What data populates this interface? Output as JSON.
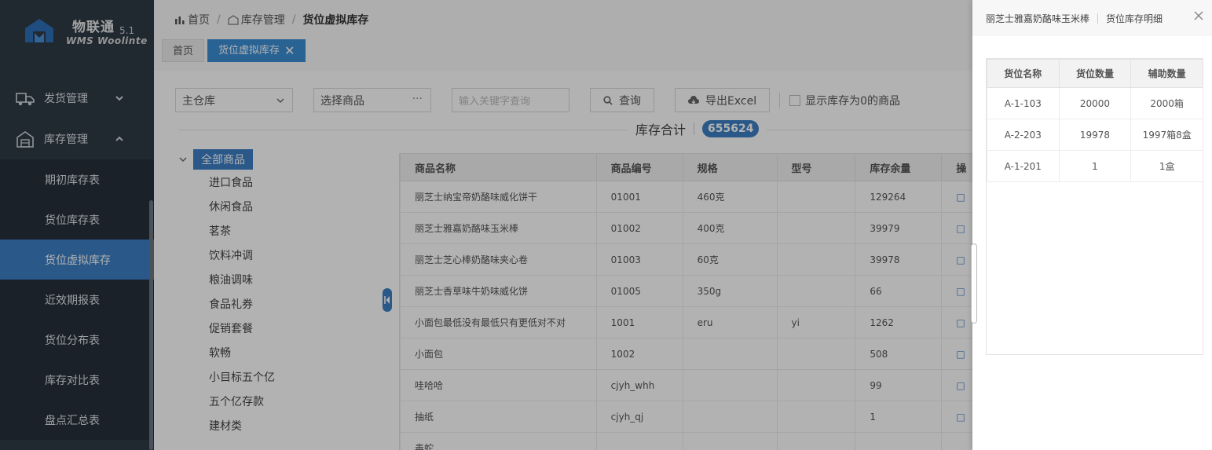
{
  "app": {
    "title": "物联通",
    "version": "5.1",
    "subtitle": "WMS Woolinte"
  },
  "sidebar": {
    "groups": [
      {
        "label": "发货管理",
        "icon": "truck-icon",
        "expanded": false
      },
      {
        "label": "库存管理",
        "icon": "warehouse-icon",
        "expanded": true
      }
    ],
    "items": [
      {
        "label": "期初库存表",
        "active": false
      },
      {
        "label": "货位库存表",
        "active": false
      },
      {
        "label": "货位虚拟库存",
        "active": true
      },
      {
        "label": "近效期报表",
        "active": false
      },
      {
        "label": "货位分布表",
        "active": false
      },
      {
        "label": "库存对比表",
        "active": false
      },
      {
        "label": "盘点汇总表",
        "active": false
      }
    ]
  },
  "breadcrumb": {
    "home": "首页",
    "section": "库存管理",
    "current": "货位虚拟库存"
  },
  "tabs": [
    {
      "label": "首页",
      "active": false
    },
    {
      "label": "货位虚拟库存",
      "active": true,
      "close": "✕"
    }
  ],
  "toolbar": {
    "warehouse": "主仓库",
    "goods_placeholder": "选择商品",
    "goods_dots": "···",
    "keyword_placeholder": "输入关键字查询",
    "query_label": "查询",
    "export_label": "导出Excel",
    "show_zero_label": "显示库存为0的商品"
  },
  "total": {
    "label": "库存合计",
    "value": "655624"
  },
  "tree": {
    "root": "全部商品",
    "items": [
      "进口食品",
      "休闲食品",
      "茗茶",
      "饮料冲调",
      "粮油调味",
      "食品礼券",
      "促销套餐",
      "软畅",
      "小目标五个亿",
      "五个亿存款",
      "建材类"
    ]
  },
  "table": {
    "headers": [
      "商品名称",
      "商品编号",
      "规格",
      "型号",
      "库存余量",
      "操"
    ],
    "rows": [
      [
        "丽芝士纳宝帝奶酪味威化饼干",
        "01001",
        "460克",
        "",
        "129264",
        "□"
      ],
      [
        "丽芝士雅嘉奶酪味玉米棒",
        "01002",
        "400克",
        "",
        "39979",
        "□"
      ],
      [
        "丽芝士芝心棒奶酪味夹心卷",
        "01003",
        "60克",
        "",
        "39978",
        "□"
      ],
      [
        "丽芝士香草味牛奶味威化饼",
        "01005",
        "350g",
        "",
        "66",
        "□"
      ],
      [
        "小面包最低没有最低只有更低对不对",
        "1001",
        "eru",
        "yi",
        "1262",
        "□"
      ],
      [
        "小面包",
        "1002",
        "",
        "",
        "508",
        "□"
      ],
      [
        "哇哈哈",
        "cjyh_whh",
        "",
        "",
        "99",
        "□"
      ],
      [
        "抽纸",
        "cjyh_qj",
        "",
        "",
        "1",
        "□"
      ],
      [
        "毒蛇",
        "",
        "",
        "",
        "",
        ""
      ]
    ]
  },
  "drawer": {
    "product": "丽芝士雅嘉奶酪味玉米棒",
    "title": "货位库存明细",
    "headers": [
      "货位名称",
      "货位数量",
      "辅助数量"
    ],
    "rows": [
      [
        "A-1-103",
        "20000",
        "2000箱"
      ],
      [
        "A-2-203",
        "19978",
        "1997箱8盒"
      ],
      [
        "A-1-201",
        "1",
        "1盒"
      ]
    ]
  },
  "colors": {
    "sidebar_bg": "#2f3a46",
    "accent": "#3b7fc4",
    "tab_active": "#3b8fd4"
  }
}
